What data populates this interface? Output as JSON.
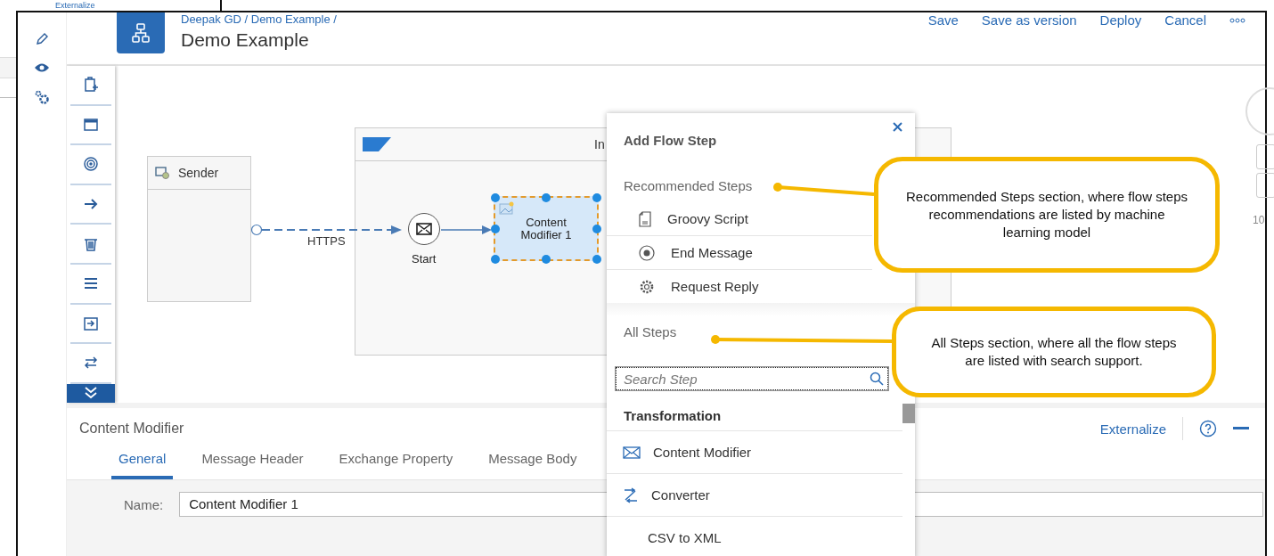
{
  "background_window": {
    "link": "Externalize"
  },
  "header": {
    "breadcrumb": "Deepak GD / Demo Example /",
    "title": "Demo Example",
    "actions": [
      "Save",
      "Save as version",
      "Deploy",
      "Cancel"
    ]
  },
  "diagram": {
    "sender": "Sender",
    "process_title": "In",
    "connection_label": "HTTPS",
    "start_label": "Start",
    "step_label": "Content Modifier 1",
    "step_selected": true,
    "zoom_label": "10"
  },
  "properties": {
    "title": "Content Modifier",
    "externalize": "Externalize",
    "tabs": [
      {
        "label": "General",
        "selected": true
      },
      {
        "label": "Message Header",
        "selected": false
      },
      {
        "label": "Exchange Property",
        "selected": false
      },
      {
        "label": "Message Body",
        "selected": false
      }
    ],
    "fields": [
      {
        "label": "Name:",
        "value": "Content Modifier 1"
      }
    ]
  },
  "popover": {
    "title": "Add Flow Step",
    "recommended_heading": "Recommended Steps",
    "recommended": [
      {
        "kind": "script",
        "label": "Groovy Script"
      },
      {
        "kind": "end",
        "label": "End Message"
      },
      {
        "kind": "gear",
        "label": "Request Reply"
      }
    ],
    "all_heading": "All Steps",
    "search_placeholder": "Search Step",
    "groups": [
      {
        "title": "Transformation",
        "items": [
          {
            "kind": "envelope",
            "label": "Content Modifier"
          },
          {
            "kind": "converter",
            "label": "Converter"
          },
          {
            "kind": "none",
            "label": "CSV to XML"
          }
        ]
      }
    ]
  },
  "callouts": [
    {
      "text": "Recommended Steps section, where flow steps recommendations are listed by machine learning model"
    },
    {
      "text": "All Steps section, where all the flow steps are listed with search support."
    }
  ]
}
